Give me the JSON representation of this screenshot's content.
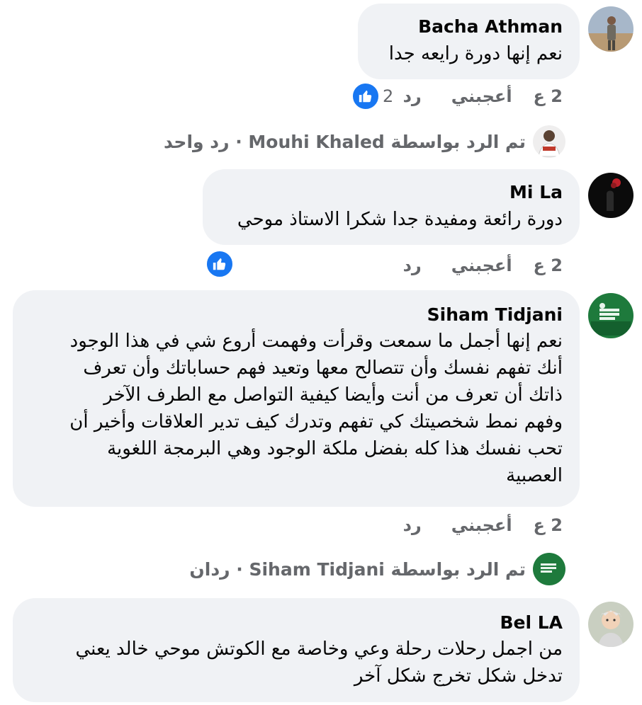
{
  "comments": [
    {
      "author": "Bacha Athman",
      "text": "نعم إنها دورة رايعه جدا",
      "time": "2 ع",
      "like_label": "أعجبني",
      "reply_label": "رد",
      "reaction_count": "2"
    },
    {
      "author": "Mi La",
      "text": "دورة رائعة ومفيدة جدا شكرا الاستاذ موحي",
      "time": "2 ع",
      "like_label": "أعجبني",
      "reply_label": "رد"
    },
    {
      "author": "Siham Tidjani",
      "text_lines": [
        "نعم إنها أجمل ما سمعت وقرأت وفهمت أروع شي في هذا الوجود",
        "أنك تفهم نفسك وأن تتصالح معها وتعيد فهم حساباتك وأن تعرف",
        "ذاتك أن تعرف من أنت وأيضا كيفية التواصل مع الطرف الآخر",
        "وفهم نمط شخصيتك كي تفهم وتدرك كيف تدير العلاقات وأخير أن",
        "تحب نفسك هذا كله بفضل ملكة الوجود وهي البرمجة اللغوية",
        "العصبية"
      ],
      "time": "2 ع",
      "like_label": "أعجبني",
      "reply_label": "رد"
    },
    {
      "author": "Bel LA",
      "text_lines": [
        "من اجمل رحلات رحلة وعي وخاصة مع الكوتش موحي خالد يعني",
        "تدخل شكل تخرج شكل آخر"
      ]
    }
  ],
  "replies_summary": [
    {
      "prefix": "تم الرد بواسطة",
      "name": "Mouhi Khaled",
      "count": "رد واحد",
      "separator": "·"
    },
    {
      "prefix": "تم الرد بواسطة",
      "name": "Siham Tidjani",
      "count": "ردان",
      "separator": "·"
    }
  ],
  "colors": {
    "bubble": "#f0f2f5",
    "secondary_text": "#65676b",
    "like_blue": "#1877f2"
  }
}
